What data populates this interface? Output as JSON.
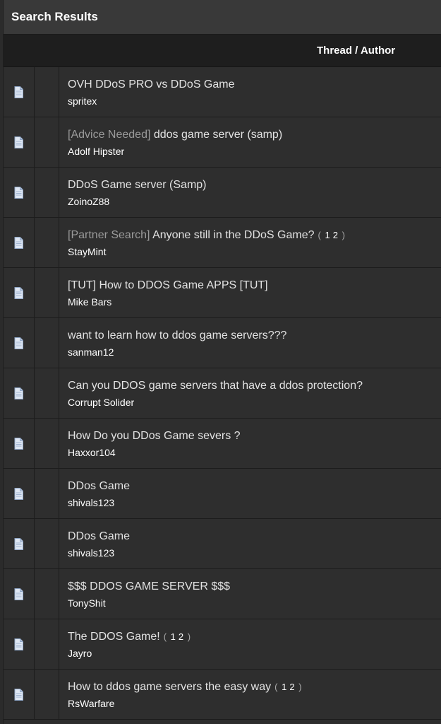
{
  "panel": {
    "title": "Search Results"
  },
  "table": {
    "header": "Thread / Author",
    "rows": [
      {
        "prefix": "",
        "title": "OVH DDoS PRO vs DDoS Game",
        "author": "spritex",
        "pages": []
      },
      {
        "prefix": "[Advice Needed]",
        "title": "ddos game server (samp)",
        "author": "Adolf Hipster",
        "pages": []
      },
      {
        "prefix": "",
        "title": "DDoS Game server (Samp)",
        "author": "ZoinoZ88",
        "pages": []
      },
      {
        "prefix": "[Partner Search]",
        "title": "Anyone still in the DDoS Game?",
        "author": "StayMint",
        "pages": [
          "1",
          "2"
        ]
      },
      {
        "prefix": "",
        "title": "[TUT] How to DDOS Game APPS [TUT]",
        "author": "Mike Bars",
        "pages": []
      },
      {
        "prefix": "",
        "title": "want to learn how to ddos game servers???",
        "author": "sanman12",
        "pages": []
      },
      {
        "prefix": "",
        "title": "Can you DDOS game servers that have a ddos protection?",
        "author": "Corrupt Solider",
        "pages": []
      },
      {
        "prefix": "",
        "title": "How Do you DDos Game severs ?",
        "author": "Haxxor104",
        "pages": []
      },
      {
        "prefix": "",
        "title": "DDos Game",
        "author": "shivals123",
        "pages": []
      },
      {
        "prefix": "",
        "title": "DDos Game",
        "author": "shivals123",
        "pages": []
      },
      {
        "prefix": "",
        "title": "$$$ DDOS GAME SERVER $$$",
        "author": "TonyShit",
        "pages": []
      },
      {
        "prefix": "",
        "title": "The DDOS Game!",
        "author": "Jayro",
        "pages": [
          "1",
          "2"
        ]
      },
      {
        "prefix": "",
        "title": "How to ddos game servers the easy way",
        "author": "RsWarfare",
        "pages": [
          "1",
          "2"
        ]
      }
    ]
  },
  "pagination_open": "(",
  "pagination_close": ")",
  "icons": {
    "thread": "document-icon"
  },
  "colors": {
    "background": "#2e2e2e",
    "header": "#1e1e1e",
    "title_bar": "#393939",
    "prefix": "#9a9a9a"
  }
}
